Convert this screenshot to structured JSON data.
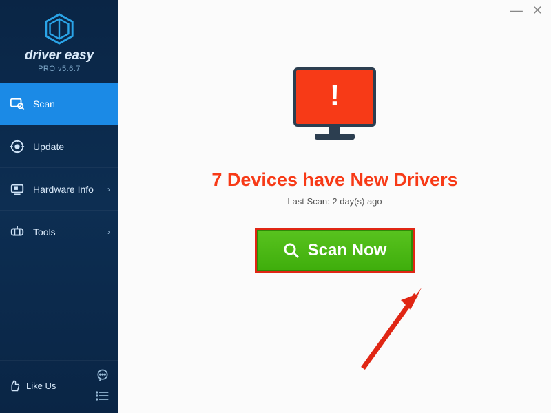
{
  "brand": {
    "name": "driver easy",
    "version": "PRO v5.6.7"
  },
  "sidebar": {
    "items": [
      {
        "label": "Scan"
      },
      {
        "label": "Update"
      },
      {
        "label": "Hardware Info"
      },
      {
        "label": "Tools"
      }
    ],
    "likeus": "Like Us"
  },
  "main": {
    "headline": "7 Devices have New Drivers",
    "subline": "Last Scan: 2 day(s) ago",
    "scan_button": "Scan Now"
  },
  "colors": {
    "accent": "#1b8ae6",
    "alert": "#f73a17",
    "scan_green": "#45b912",
    "sidebar": "#0b2a4c"
  }
}
